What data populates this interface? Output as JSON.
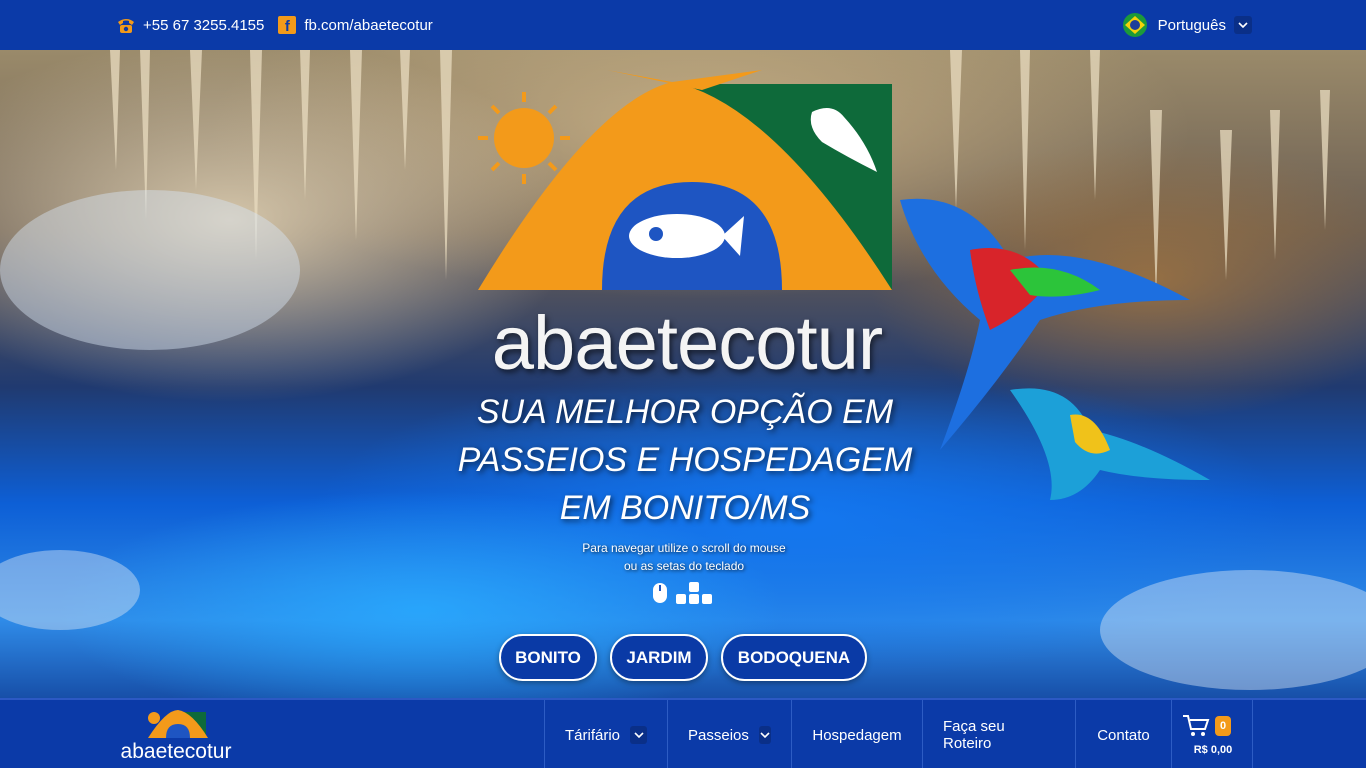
{
  "topbar": {
    "phone": "+55 67 3255.4155",
    "facebook": "fb.com/abaetecotur",
    "language": "Português"
  },
  "hero": {
    "brand": "abaetecotur",
    "tagline_lines": [
      "SUA MELHOR OPÇÃO EM",
      "PASSEIOS E HOSPEDAGEM",
      "EM BONITO/MS"
    ],
    "hint_lines": [
      "Para navegar utilize o scroll do mouse",
      "ou as setas do teclado"
    ],
    "city_buttons": [
      "BONITO",
      "JARDIM",
      "BODOQUENA"
    ]
  },
  "navbar": {
    "brand": "abaetecotur",
    "menu": [
      "Tárifário",
      "Passeios",
      "Hospedagem",
      "Faça seu Roteiro",
      "Contato"
    ],
    "cart_count": "0",
    "cart_total": "R$ 0,00"
  },
  "icons": {
    "phone": "phone-icon",
    "facebook": "facebook-icon",
    "flag": "brazil-flag-icon",
    "chevron": "chevron-down-icon",
    "mouse": "mouse-icon",
    "arrows": "arrow-keys-icon",
    "cart": "cart-icon"
  },
  "colors": {
    "primary": "#0b3aa8",
    "accent_orange": "#f39a1a",
    "logo_green": "#0e6a3a"
  }
}
